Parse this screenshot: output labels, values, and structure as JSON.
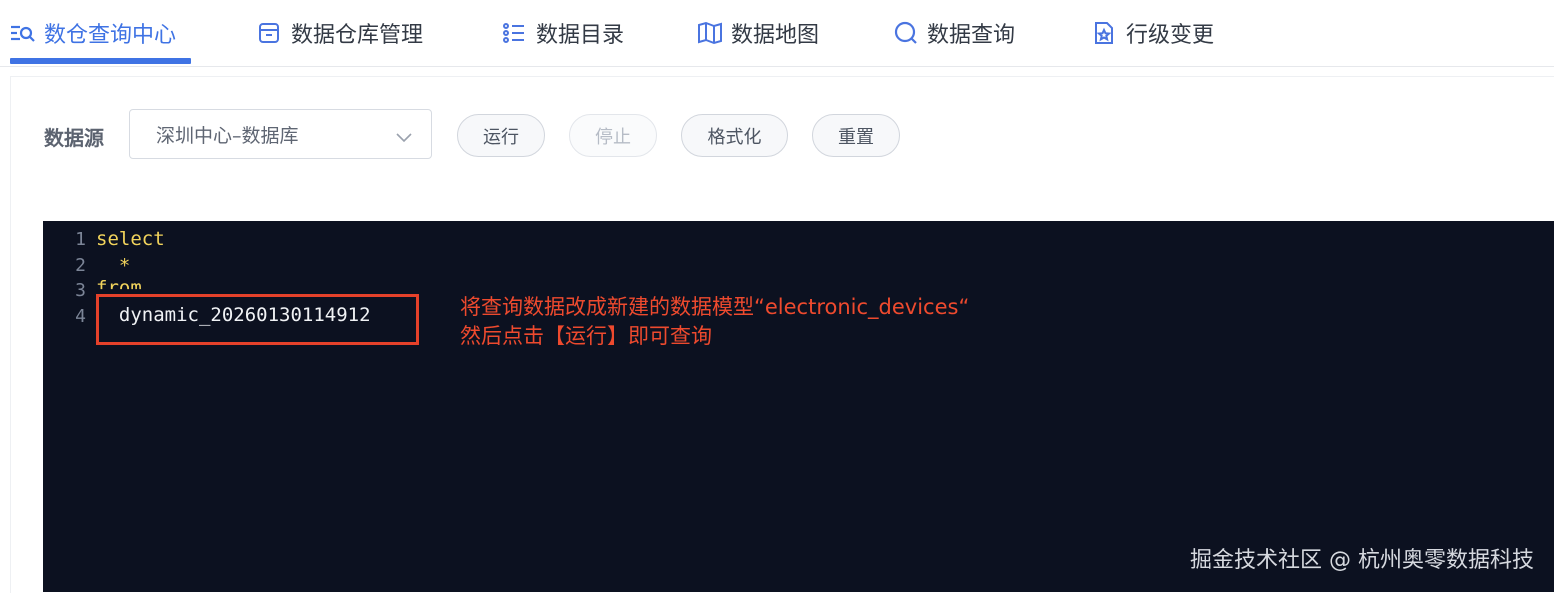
{
  "tabs": [
    {
      "label": "数仓查询中心",
      "icon": "search-list-icon",
      "active": true
    },
    {
      "label": "数据仓库管理",
      "icon": "archive-box-icon",
      "active": false
    },
    {
      "label": "数据目录",
      "icon": "list-icon",
      "active": false
    },
    {
      "label": "数据地图",
      "icon": "map-icon",
      "active": false
    },
    {
      "label": "数据查询",
      "icon": "search-icon",
      "active": false
    },
    {
      "label": "行级变更",
      "icon": "file-star-icon",
      "active": false
    }
  ],
  "toolbar": {
    "datasource_label": "数据源",
    "datasource_value": "深圳中心–数据库",
    "run_label": "运行",
    "stop_label": "停止",
    "format_label": "格式化",
    "reset_label": "重置"
  },
  "editor": {
    "lines": [
      {
        "num": "1",
        "text": "select"
      },
      {
        "num": "2",
        "text": "  *"
      },
      {
        "num": "3",
        "text": "from"
      },
      {
        "num": "4",
        "text": "  dynamic_20260130114912"
      }
    ]
  },
  "annotation": {
    "line1": "将查询数据改成新建的数据模型“electronic_devices“",
    "line2": "然后点击【运行】即可查询"
  },
  "watermark": "掘金技术社区 @ 杭州奥零数据科技",
  "colors": {
    "accent": "#3f73e4",
    "editor_bg": "#0c1120",
    "keyword": "#f2d45c",
    "annotation_red": "#ee4a2e"
  }
}
